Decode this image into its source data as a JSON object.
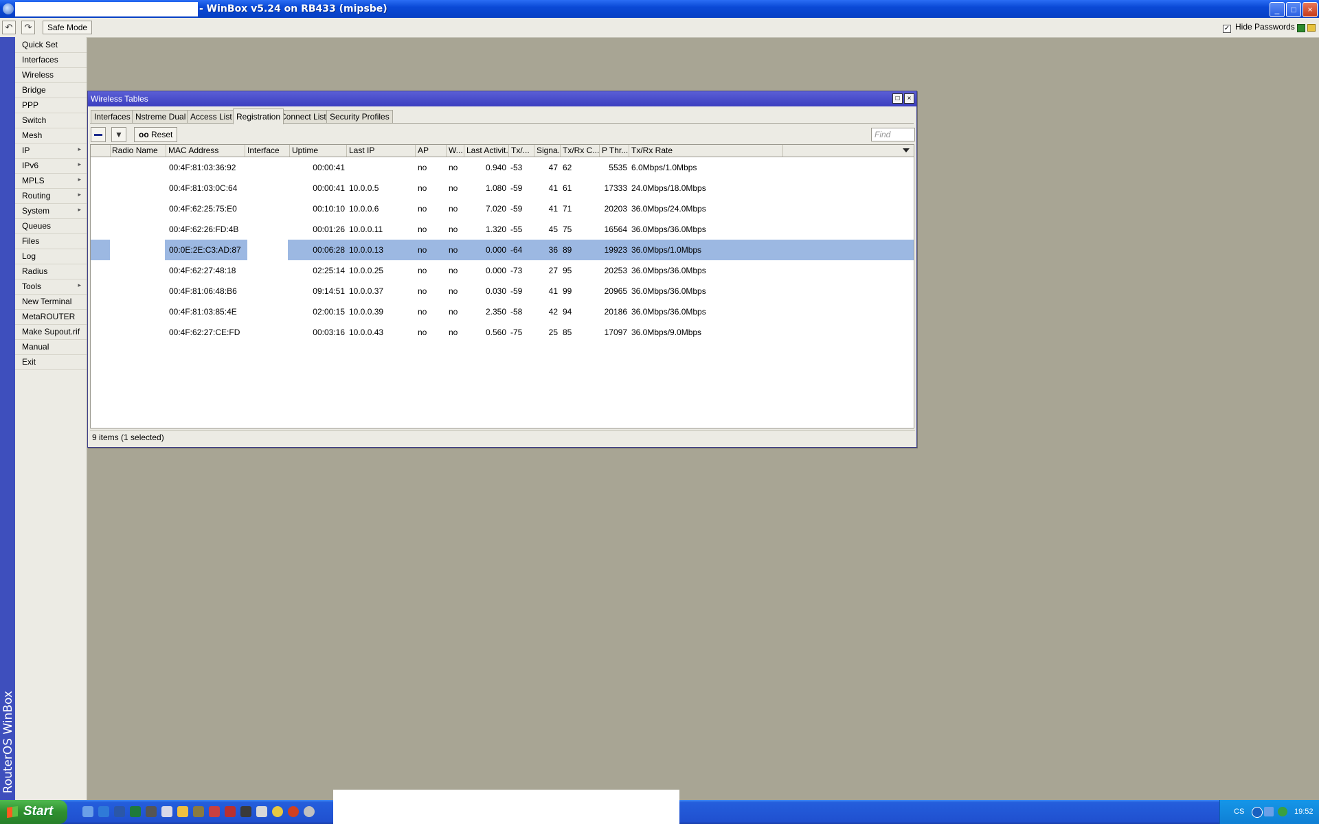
{
  "app": {
    "title": "- WinBox v5.24 on RB433 (mipsbe)",
    "window_buttons": [
      "_",
      "□",
      "×"
    ]
  },
  "toolbar": {
    "undo_icon": "undo-icon",
    "redo_icon": "redo-icon",
    "safe_mode_label": "Safe Mode",
    "hide_passwords_label": "Hide Passwords",
    "hide_passwords_checked": true
  },
  "sidebar": {
    "brand": "RouterOS WinBox",
    "items": [
      {
        "label": "Quick Set",
        "submenu": false
      },
      {
        "label": "Interfaces",
        "submenu": false
      },
      {
        "label": "Wireless",
        "submenu": false
      },
      {
        "label": "Bridge",
        "submenu": false
      },
      {
        "label": "PPP",
        "submenu": false
      },
      {
        "label": "Switch",
        "submenu": false
      },
      {
        "label": "Mesh",
        "submenu": false
      },
      {
        "label": "IP",
        "submenu": true
      },
      {
        "label": "IPv6",
        "submenu": true
      },
      {
        "label": "MPLS",
        "submenu": true
      },
      {
        "label": "Routing",
        "submenu": true
      },
      {
        "label": "System",
        "submenu": true
      },
      {
        "label": "Queues",
        "submenu": false
      },
      {
        "label": "Files",
        "submenu": false
      },
      {
        "label": "Log",
        "submenu": false
      },
      {
        "label": "Radius",
        "submenu": false
      },
      {
        "label": "Tools",
        "submenu": true
      },
      {
        "label": "New Terminal",
        "submenu": false
      },
      {
        "label": "MetaROUTER",
        "submenu": false
      },
      {
        "label": "Make Supout.rif",
        "submenu": false
      },
      {
        "label": "Manual",
        "submenu": false
      },
      {
        "label": "Exit",
        "submenu": false
      }
    ]
  },
  "window": {
    "title": "Wireless Tables",
    "tabs": [
      "Interfaces",
      "Nstreme Dual",
      "Access List",
      "Registration",
      "Connect List",
      "Security Profiles"
    ],
    "active_tab": "Registration",
    "reset_label": "Reset",
    "reset_prefix": "oo",
    "find_placeholder": "Find",
    "columns": [
      "Radio Name",
      "MAC Address",
      "Interface",
      "Uptime",
      "Last IP",
      "AP",
      "W...",
      "Last Activit...",
      "Tx/...",
      "Signa...",
      "Tx/Rx C...",
      "P Thr...",
      "Tx/Rx Rate"
    ],
    "rows": [
      {
        "mac": "00:4F:81:03:36:92",
        "uptime": "00:00:41",
        "last_ip": "",
        "ap": "no",
        "w": "no",
        "last_activity": "0.940",
        "tx": "-53",
        "signal": "47",
        "txrx_c": "62",
        "p_thr": "5535",
        "rate": "6.0Mbps/1.0Mbps",
        "selected": false
      },
      {
        "mac": "00:4F:81:03:0C:64",
        "uptime": "00:00:41",
        "last_ip": "10.0.0.5",
        "ap": "no",
        "w": "no",
        "last_activity": "1.080",
        "tx": "-59",
        "signal": "41",
        "txrx_c": "61",
        "p_thr": "17333",
        "rate": "24.0Mbps/18.0Mbps",
        "selected": false
      },
      {
        "mac": "00:4F:62:25:75:E0",
        "uptime": "00:10:10",
        "last_ip": "10.0.0.6",
        "ap": "no",
        "w": "no",
        "last_activity": "7.020",
        "tx": "-59",
        "signal": "41",
        "txrx_c": "71",
        "p_thr": "20203",
        "rate": "36.0Mbps/24.0Mbps",
        "selected": false
      },
      {
        "mac": "00:4F:62:26:FD:4B",
        "uptime": "00:01:26",
        "last_ip": "10.0.0.11",
        "ap": "no",
        "w": "no",
        "last_activity": "1.320",
        "tx": "-55",
        "signal": "45",
        "txrx_c": "75",
        "p_thr": "16564",
        "rate": "36.0Mbps/36.0Mbps",
        "selected": false
      },
      {
        "mac": "00:0E:2E:C3:AD:87",
        "uptime": "00:06:28",
        "last_ip": "10.0.0.13",
        "ap": "no",
        "w": "no",
        "last_activity": "0.000",
        "tx": "-64",
        "signal": "36",
        "txrx_c": "89",
        "p_thr": "19923",
        "rate": "36.0Mbps/1.0Mbps",
        "selected": true
      },
      {
        "mac": "00:4F:62:27:48:18",
        "uptime": "02:25:14",
        "last_ip": "10.0.0.25",
        "ap": "no",
        "w": "no",
        "last_activity": "0.000",
        "tx": "-73",
        "signal": "27",
        "txrx_c": "95",
        "p_thr": "20253",
        "rate": "36.0Mbps/36.0Mbps",
        "selected": false
      },
      {
        "mac": "00:4F:81:06:48:B6",
        "uptime": "09:14:51",
        "last_ip": "10.0.0.37",
        "ap": "no",
        "w": "no",
        "last_activity": "0.030",
        "tx": "-59",
        "signal": "41",
        "txrx_c": "99",
        "p_thr": "20965",
        "rate": "36.0Mbps/36.0Mbps",
        "selected": false
      },
      {
        "mac": "00:4F:81:03:85:4E",
        "uptime": "02:00:15",
        "last_ip": "10.0.0.39",
        "ap": "no",
        "w": "no",
        "last_activity": "2.350",
        "tx": "-58",
        "signal": "42",
        "txrx_c": "94",
        "p_thr": "20186",
        "rate": "36.0Mbps/36.0Mbps",
        "selected": false
      },
      {
        "mac": "00:4F:62:27:CE:FD",
        "uptime": "00:03:16",
        "last_ip": "10.0.0.43",
        "ap": "no",
        "w": "no",
        "last_activity": "0.560",
        "tx": "-75",
        "signal": "25",
        "txrx_c": "85",
        "p_thr": "17097",
        "rate": "36.0Mbps/9.0Mbps",
        "selected": false
      }
    ],
    "status": "9 items (1 selected)"
  },
  "taskbar": {
    "start_label": "Start",
    "language": "CS",
    "clock": "19:52"
  },
  "colors": {
    "desktop": "#a8a594",
    "selection": "#9cb8e2",
    "title_bar": "#0a49d6",
    "sidebar_strip": "#3e4fbd"
  }
}
